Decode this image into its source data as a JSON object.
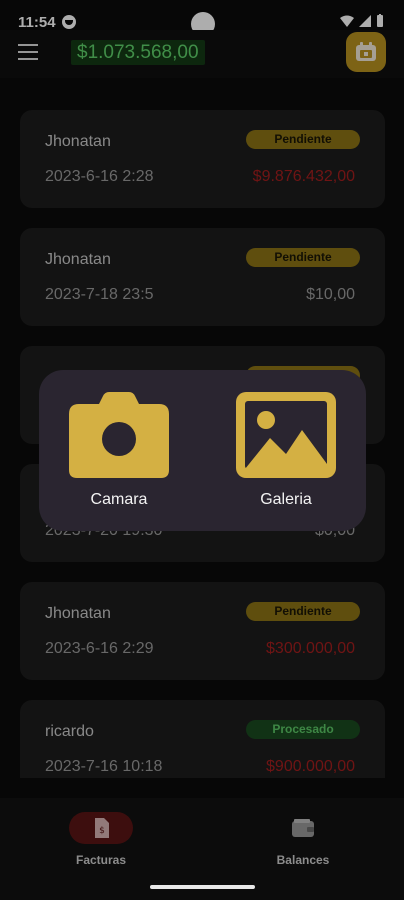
{
  "status": {
    "time": "11:54"
  },
  "header": {
    "balance": "$1.073.568,00"
  },
  "invoices": [
    {
      "name": "Jhonatan",
      "date": "2023-6-16 2:28",
      "status": "Pendiente",
      "amount": "$9.876.432,00",
      "amount_style": "negative"
    },
    {
      "name": "Jhonatan",
      "date": "2023-7-18 23:5",
      "status": "Pendiente",
      "amount": "$10,00",
      "amount_style": "neutral"
    },
    {
      "name": "",
      "date": "",
      "status": "",
      "amount": "",
      "amount_style": "neutral"
    },
    {
      "name": "",
      "date": "2023-7-20 19:30",
      "status": "",
      "amount": "$0,00",
      "amount_style": "neutral"
    },
    {
      "name": "Jhonatan",
      "date": "2023-6-16 2:29",
      "status": "Pendiente",
      "amount": "$300.000,00",
      "amount_style": "negative"
    },
    {
      "name": "ricardo",
      "date": "2023-7-16 10:18",
      "status": "Procesado",
      "amount": "$900.000,00",
      "amount_style": "negative"
    }
  ],
  "picker": {
    "camera_label": "Camara",
    "gallery_label": "Galeria"
  },
  "nav": {
    "facturas_label": "Facturas",
    "balances_label": "Balances"
  },
  "colors": {
    "accent": "#b9921f",
    "balance_green": "#5fd16a",
    "negative": "#a41e1e",
    "picker_bg": "#2a2530"
  },
  "icons": {
    "menu": "menu-icon",
    "add": "receipt-add-icon",
    "camera": "camera-icon",
    "gallery": "image-icon",
    "invoice": "invoice-icon",
    "wallet": "wallet-icon"
  }
}
